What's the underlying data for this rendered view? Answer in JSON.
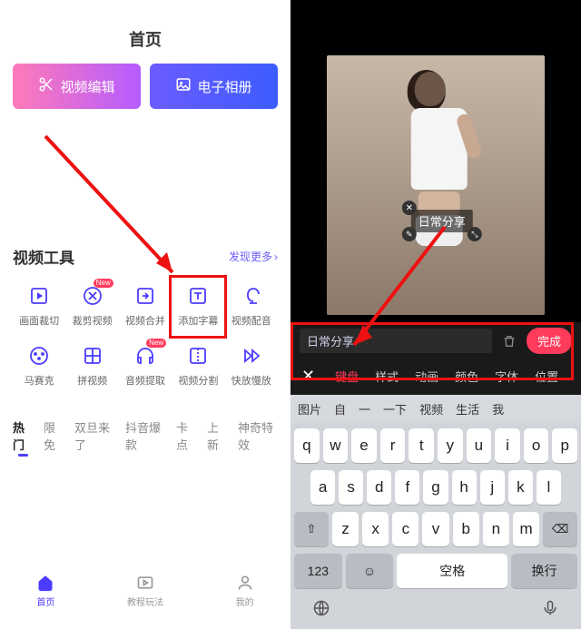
{
  "left": {
    "title": "首页",
    "hero": {
      "edit": "视频编辑",
      "album": "电子相册"
    },
    "section": {
      "title": "视频工具",
      "more": "发现更多"
    },
    "tools_row1": [
      {
        "label": "画面裁切",
        "name": "crop"
      },
      {
        "label": "裁剪视频",
        "name": "trim",
        "new": true
      },
      {
        "label": "视频合并",
        "name": "merge"
      },
      {
        "label": "添加字幕",
        "name": "subtitle"
      },
      {
        "label": "视频配音",
        "name": "dub"
      }
    ],
    "tools_row2": [
      {
        "label": "马赛克",
        "name": "mosaic"
      },
      {
        "label": "拼视频",
        "name": "collage"
      },
      {
        "label": "音频提取",
        "name": "audio-extract",
        "new": true
      },
      {
        "label": "视频分割",
        "name": "split"
      },
      {
        "label": "快放慢放",
        "name": "speed"
      }
    ],
    "tabs": [
      "热门",
      "限免",
      "双旦来了",
      "抖音爆款",
      "卡点",
      "上新",
      "神奇特效"
    ],
    "nav": [
      {
        "label": "首页",
        "name": "home",
        "active": true
      },
      {
        "label": "教程玩法",
        "name": "tutorial"
      },
      {
        "label": "我的",
        "name": "profile"
      }
    ]
  },
  "right": {
    "caption_text": "日常分享",
    "input_value": "日常分享",
    "done": "完成",
    "style_tabs": [
      "键盘",
      "样式",
      "动画",
      "颜色",
      "字体",
      "位置"
    ],
    "suggestions": [
      "图片",
      "自",
      "一",
      "一下",
      "视频",
      "生活",
      "我"
    ],
    "keys_r1": [
      "q",
      "w",
      "e",
      "r",
      "t",
      "y",
      "u",
      "i",
      "o",
      "p"
    ],
    "keys_r2": [
      "a",
      "s",
      "d",
      "f",
      "g",
      "h",
      "j",
      "k",
      "l"
    ],
    "keys_r3": [
      "z",
      "x",
      "c",
      "v",
      "b",
      "n",
      "m"
    ],
    "shift": "⇧",
    "backspace": "⌫",
    "num": "123",
    "emoji": "☺",
    "space": "空格",
    "enter": "换行"
  }
}
